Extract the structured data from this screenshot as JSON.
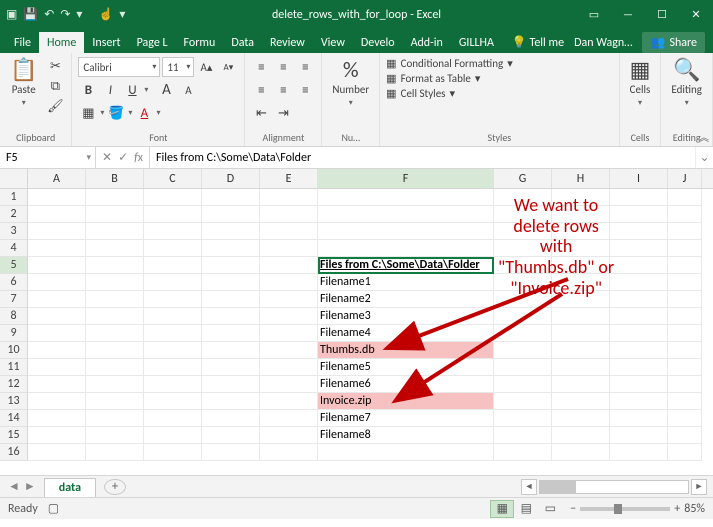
{
  "titlebar": {
    "title": "delete_rows_with_for_loop - Excel"
  },
  "tabs": {
    "file": "File",
    "home": "Home",
    "insert": "Insert",
    "page": "Page L",
    "formulas": "Formu",
    "data": "Data",
    "review": "Review",
    "view": "View",
    "developer": "Develo",
    "addins": "Add-in",
    "gillha": "GILLHA",
    "tell": "Tell me",
    "user": "Dan Wagn…",
    "share": "Share"
  },
  "ribbon": {
    "clipboard": {
      "paste": "Paste",
      "label": "Clipboard"
    },
    "font": {
      "name": "Calibri",
      "size": "11",
      "label": "Font"
    },
    "alignment": {
      "label": "Alignment"
    },
    "number": {
      "name": "Number",
      "label": "Nu…"
    },
    "styles": {
      "cond": "Conditional Formatting",
      "table": "Format as Table",
      "cell": "Cell Styles",
      "label": "Styles"
    },
    "cells": {
      "name": "Cells",
      "label": "Cells"
    },
    "editing": {
      "name": "Editing",
      "label": "Editing"
    }
  },
  "namebox": "F5",
  "fx": "Files from C:\\Some\\Data\\Folder",
  "cols": [
    "A",
    "B",
    "C",
    "D",
    "E",
    "F",
    "G",
    "H",
    "I",
    "J"
  ],
  "rows": [
    {
      "n": 1,
      "f": ""
    },
    {
      "n": 2,
      "f": ""
    },
    {
      "n": 3,
      "f": ""
    },
    {
      "n": 4,
      "f": ""
    },
    {
      "n": 5,
      "f": "Files from C:\\Some\\Data\\Folder",
      "sel": true,
      "hdr": true
    },
    {
      "n": 6,
      "f": "Filename1"
    },
    {
      "n": 7,
      "f": "Filename2"
    },
    {
      "n": 8,
      "f": "Filename3"
    },
    {
      "n": 9,
      "f": "Filename4"
    },
    {
      "n": 10,
      "f": "Thumbs.db",
      "hl": true
    },
    {
      "n": 11,
      "f": "Filename5"
    },
    {
      "n": 12,
      "f": "Filename6"
    },
    {
      "n": 13,
      "f": "Invoice.zip",
      "hl": true
    },
    {
      "n": 14,
      "f": "Filename7"
    },
    {
      "n": 15,
      "f": "Filename8"
    },
    {
      "n": 16,
      "f": ""
    }
  ],
  "annotation": {
    "l1": "We want to",
    "l2": "delete rows",
    "l3": "with",
    "l4": "\"Thumbs.db\" or",
    "l5": "\"Invoice.zip\""
  },
  "sheet": {
    "name": "data"
  },
  "status": {
    "ready": "Ready",
    "zoom": "85%"
  }
}
